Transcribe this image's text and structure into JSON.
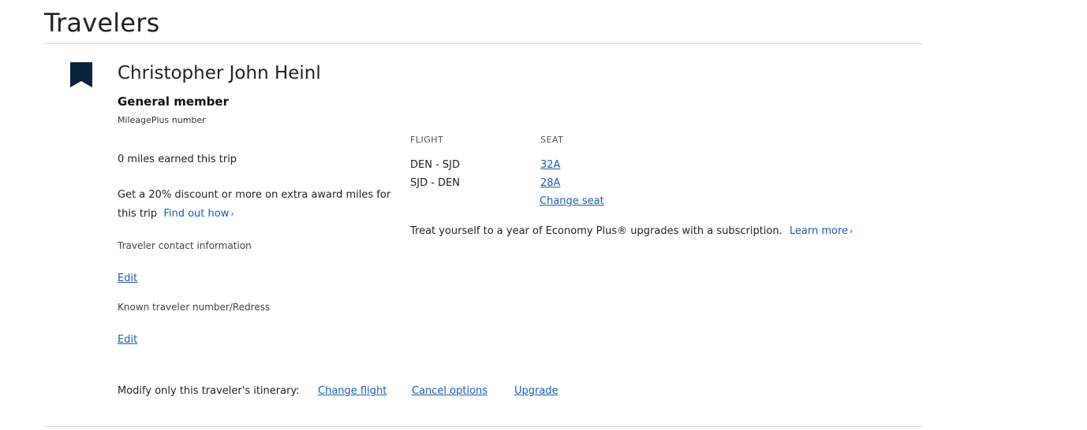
{
  "section": {
    "title": "Travelers"
  },
  "traveler": {
    "name": "Christopher John Heinl",
    "tier": "General member",
    "mileageplus_label": "MileagePlus number",
    "miles_earned": "0 miles earned this trip",
    "discount_text": "Get a 20% discount or more on extra award miles for this trip",
    "find_out_link": "Find out how",
    "contact_label": "Traveler contact information",
    "contact_edit": "Edit",
    "ktn_label": "Known traveler number/Redress",
    "ktn_edit": "Edit"
  },
  "flights": {
    "flight_header": "FLIGHT",
    "seat_header": "SEAT",
    "rows": [
      {
        "route": "DEN - SJD",
        "seat": "32A"
      },
      {
        "route": "SJD - DEN",
        "seat": "28A"
      }
    ],
    "change_seat": "Change seat",
    "promo_text": "Treat yourself to a year of Economy Plus® upgrades with a subscription.",
    "learn_more": "Learn more"
  },
  "modify": {
    "label": "Modify only this traveler's itinerary:",
    "change_flight": "Change flight",
    "cancel_options": "Cancel options",
    "upgrade": "Upgrade"
  },
  "colors": {
    "bookmark": "#0c2340",
    "link": "#1a5db5"
  },
  "icons": {
    "bookmark": "bookmark-icon",
    "chevron": "chevron-right-icon"
  }
}
